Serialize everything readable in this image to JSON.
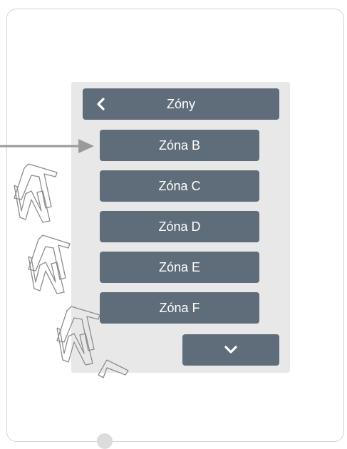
{
  "header": {
    "title": "Zóny",
    "back_icon": "chevron-left-icon"
  },
  "zones": [
    {
      "label": "Zóna B"
    },
    {
      "label": "Zóna C"
    },
    {
      "label": "Zóna D"
    },
    {
      "label": "Zóna E"
    },
    {
      "label": "Zóna F"
    }
  ],
  "scroll_down_icon": "chevron-down-icon",
  "colors": {
    "button": "#5f6d7a",
    "panel": "#e8e8e8",
    "arrow": "#9a9a9a",
    "watermark": "#8c8c8c"
  }
}
